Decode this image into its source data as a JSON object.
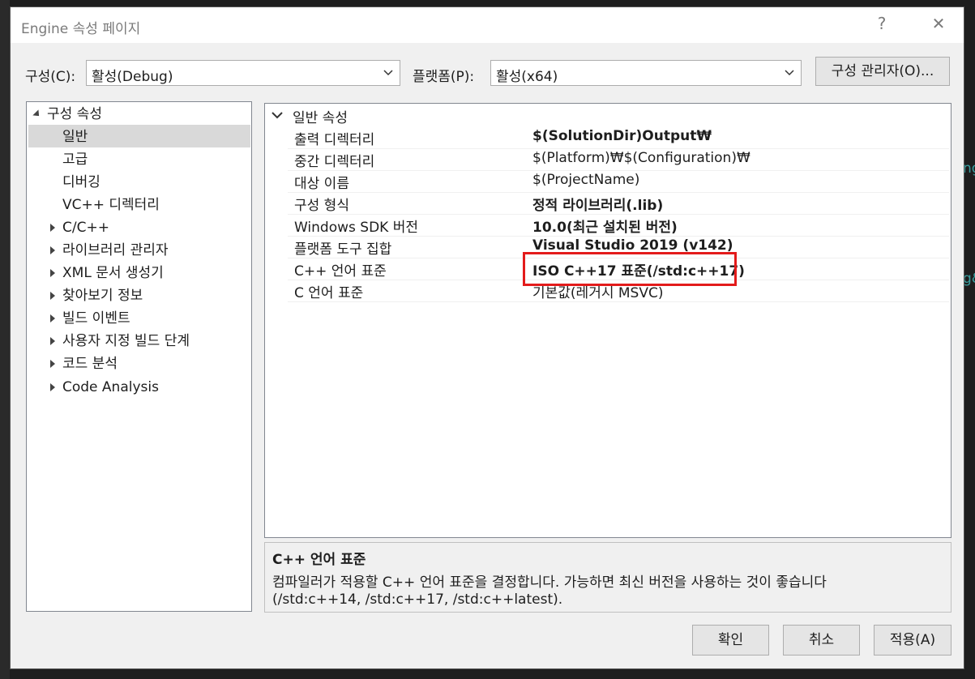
{
  "window": {
    "title": "Engine 속성 페이지",
    "help_glyph": "?",
    "close_glyph": "✕"
  },
  "background": {
    "frag1": "ng",
    "frag2": "g&"
  },
  "toolbar": {
    "config_label": "구성(C):",
    "config_value": "활성(Debug)",
    "platform_label": "플랫폼(P):",
    "platform_value": "활성(x64)",
    "config_manager_label": "구성 관리자(O)..."
  },
  "tree": {
    "root": "구성 속성",
    "items": [
      {
        "label": "일반",
        "selected": true,
        "expandable": false
      },
      {
        "label": "고급",
        "expandable": false
      },
      {
        "label": "디버깅",
        "expandable": false
      },
      {
        "label": "VC++ 디렉터리",
        "expandable": false
      },
      {
        "label": "C/C++",
        "expandable": true
      },
      {
        "label": "라이브러리 관리자",
        "expandable": true
      },
      {
        "label": "XML 문서 생성기",
        "expandable": true
      },
      {
        "label": "찾아보기 정보",
        "expandable": true
      },
      {
        "label": "빌드 이벤트",
        "expandable": true
      },
      {
        "label": "사용자 지정 빌드 단계",
        "expandable": true
      },
      {
        "label": "코드 분석",
        "expandable": true
      },
      {
        "label": "Code Analysis",
        "expandable": true
      }
    ]
  },
  "grid": {
    "category": "일반 속성",
    "rows": [
      {
        "name": "출력 디렉터리",
        "value": "$(SolutionDir)Output₩",
        "bold": true
      },
      {
        "name": "중간 디렉터리",
        "value": "$(Platform)₩$(Configuration)₩",
        "bold": false
      },
      {
        "name": "대상 이름",
        "value": "$(ProjectName)",
        "bold": false
      },
      {
        "name": "구성 형식",
        "value": "정적 라이브러리(.lib)",
        "bold": true
      },
      {
        "name": "Windows SDK 버전",
        "value": "10.0(최근 설치된 버전)",
        "bold": true
      },
      {
        "name": "플랫폼 도구 집합",
        "value": "Visual Studio 2019 (v142)",
        "bold": true
      },
      {
        "name": "C++ 언어 표준",
        "value": "ISO C++17 표준(/std:c++17)",
        "bold": true,
        "highlighted": true
      },
      {
        "name": "C 언어 표준",
        "value": "기본값(레거시 MSVC)",
        "bold": false
      }
    ]
  },
  "description": {
    "title": "C++ 언어 표준",
    "line1": "컴파일러가 적용할 C++ 언어 표준을 결정합니다. 가능하면 최신 버전을 사용하는 것이 좋습니다",
    "line2": "(/std:c++14, /std:c++17, /std:c++latest)."
  },
  "buttons": {
    "ok": "확인",
    "cancel": "취소",
    "apply": "적용(A)"
  },
  "colors": {
    "highlight": "#e31b1b",
    "selection": "#d9d9d9"
  }
}
